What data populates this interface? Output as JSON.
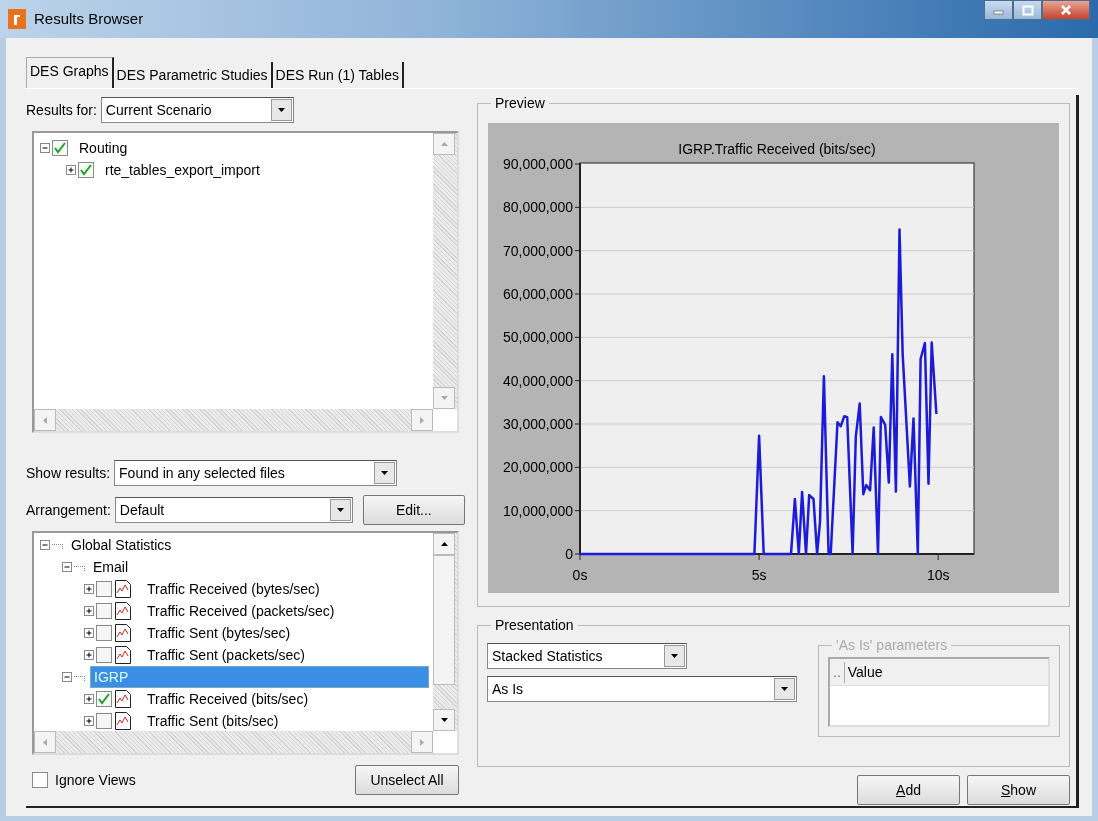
{
  "window": {
    "title": "Results Browser"
  },
  "tabs": [
    {
      "label": "DES Graphs",
      "selected": true
    },
    {
      "label": "DES Parametric Studies",
      "selected": false
    },
    {
      "label": "DES Run (1) Tables",
      "selected": false
    }
  ],
  "results_for": {
    "label": "Results for:",
    "value": "Current Scenario"
  },
  "scenario_tree": [
    {
      "label": "Routing",
      "checked": true,
      "expanded": true,
      "children": [
        {
          "label": "rte_tables_export_import",
          "checked": true,
          "expanded": false
        }
      ]
    }
  ],
  "show_results": {
    "label": "Show results:",
    "value": "Found in any selected files"
  },
  "arrangement": {
    "label": "Arrangement:",
    "value": "Default",
    "edit_button": "Edit..."
  },
  "statistics_tree": [
    {
      "label": "Global Statistics",
      "kind": "group",
      "expanded": true,
      "selected": false,
      "children": [
        {
          "label": "Email",
          "kind": "group",
          "expanded": true,
          "selected": false,
          "children": [
            {
              "label": "Traffic Received (bytes/sec)",
              "kind": "statistic",
              "expanded": false,
              "checked": false,
              "selected": false
            },
            {
              "label": "Traffic Received (packets/sec)",
              "kind": "statistic",
              "expanded": false,
              "checked": false,
              "selected": false
            },
            {
              "label": "Traffic Sent (bytes/sec)",
              "kind": "statistic",
              "expanded": false,
              "checked": false,
              "selected": false
            },
            {
              "label": "Traffic Sent (packets/sec)",
              "kind": "statistic",
              "expanded": false,
              "checked": false,
              "selected": false
            }
          ]
        },
        {
          "label": "IGRP",
          "kind": "group",
          "expanded": true,
          "selected": true,
          "children": [
            {
              "label": "Traffic Received (bits/sec)",
              "kind": "statistic",
              "expanded": false,
              "checked": true,
              "selected": false
            },
            {
              "label": "Traffic Sent (bits/sec)",
              "kind": "statistic",
              "expanded": false,
              "checked": false,
              "selected": false
            }
          ]
        }
      ]
    }
  ],
  "ignore_views": {
    "label": "Ignore Views",
    "checked": false
  },
  "unselect_all_button": "Unselect All",
  "preview": {
    "title": "Preview",
    "chart_data": {
      "type": "line",
      "title": "IGRP.Traffic Received (bits/sec)",
      "x": [
        0,
        4.87,
        5.0,
        5.13,
        5.89,
        6.0,
        6.11,
        6.2,
        6.31,
        6.4,
        6.52,
        6.62,
        6.7,
        6.81,
        6.94,
        7.0,
        7.19,
        7.28,
        7.38,
        7.46,
        7.61,
        7.7,
        7.81,
        7.91,
        7.99,
        8.1,
        8.2,
        8.32,
        8.4,
        8.52,
        8.62,
        8.72,
        8.82,
        8.92,
        9.01,
        9.21,
        9.31,
        9.43,
        9.51,
        9.63,
        9.73,
        9.82,
        9.95
      ],
      "series": [
        {
          "color": "#1c1cd8",
          "values": [
            0,
            0,
            27300000,
            0,
            0,
            12700000,
            0,
            14300000,
            0,
            13600000,
            12700000,
            0,
            7400000,
            41000000,
            0,
            0,
            30400000,
            29500000,
            31800000,
            31600000,
            0,
            27100000,
            34700000,
            13800000,
            15900000,
            14700000,
            29200000,
            0,
            31600000,
            29800000,
            16500000,
            46100000,
            14400000,
            74900000,
            46000000,
            15600000,
            31300000,
            0,
            45000000,
            48700000,
            16200000,
            48800000,
            32300000
          ]
        }
      ],
      "xlim": [
        0,
        11
      ],
      "ylim": [
        0,
        90000000
      ],
      "grid": true,
      "xticks": [
        {
          "value": 0,
          "label": "0s"
        },
        {
          "value": 5,
          "label": "5s"
        },
        {
          "value": 10,
          "label": "10s"
        }
      ],
      "yticks": [
        {
          "value": 0,
          "label": "0"
        },
        {
          "value": 10000000,
          "label": "10,000,000"
        },
        {
          "value": 20000000,
          "label": "20,000,000"
        },
        {
          "value": 30000000,
          "label": "30,000,000"
        },
        {
          "value": 40000000,
          "label": "40,000,000"
        },
        {
          "value": 50000000,
          "label": "50,000,000"
        },
        {
          "value": 60000000,
          "label": "60,000,000"
        },
        {
          "value": 70000000,
          "label": "70,000,000"
        },
        {
          "value": 80000000,
          "label": "80,000,000"
        },
        {
          "value": 90000000,
          "label": "90,000,000"
        }
      ]
    }
  },
  "presentation": {
    "title": "Presentation",
    "mode": "Stacked Statistics",
    "filter": "As Is",
    "parameters": {
      "title": "'As Is' parameters",
      "columns": [
        "..",
        "Value"
      ]
    }
  },
  "buttons": [
    "Add",
    "Show"
  ]
}
